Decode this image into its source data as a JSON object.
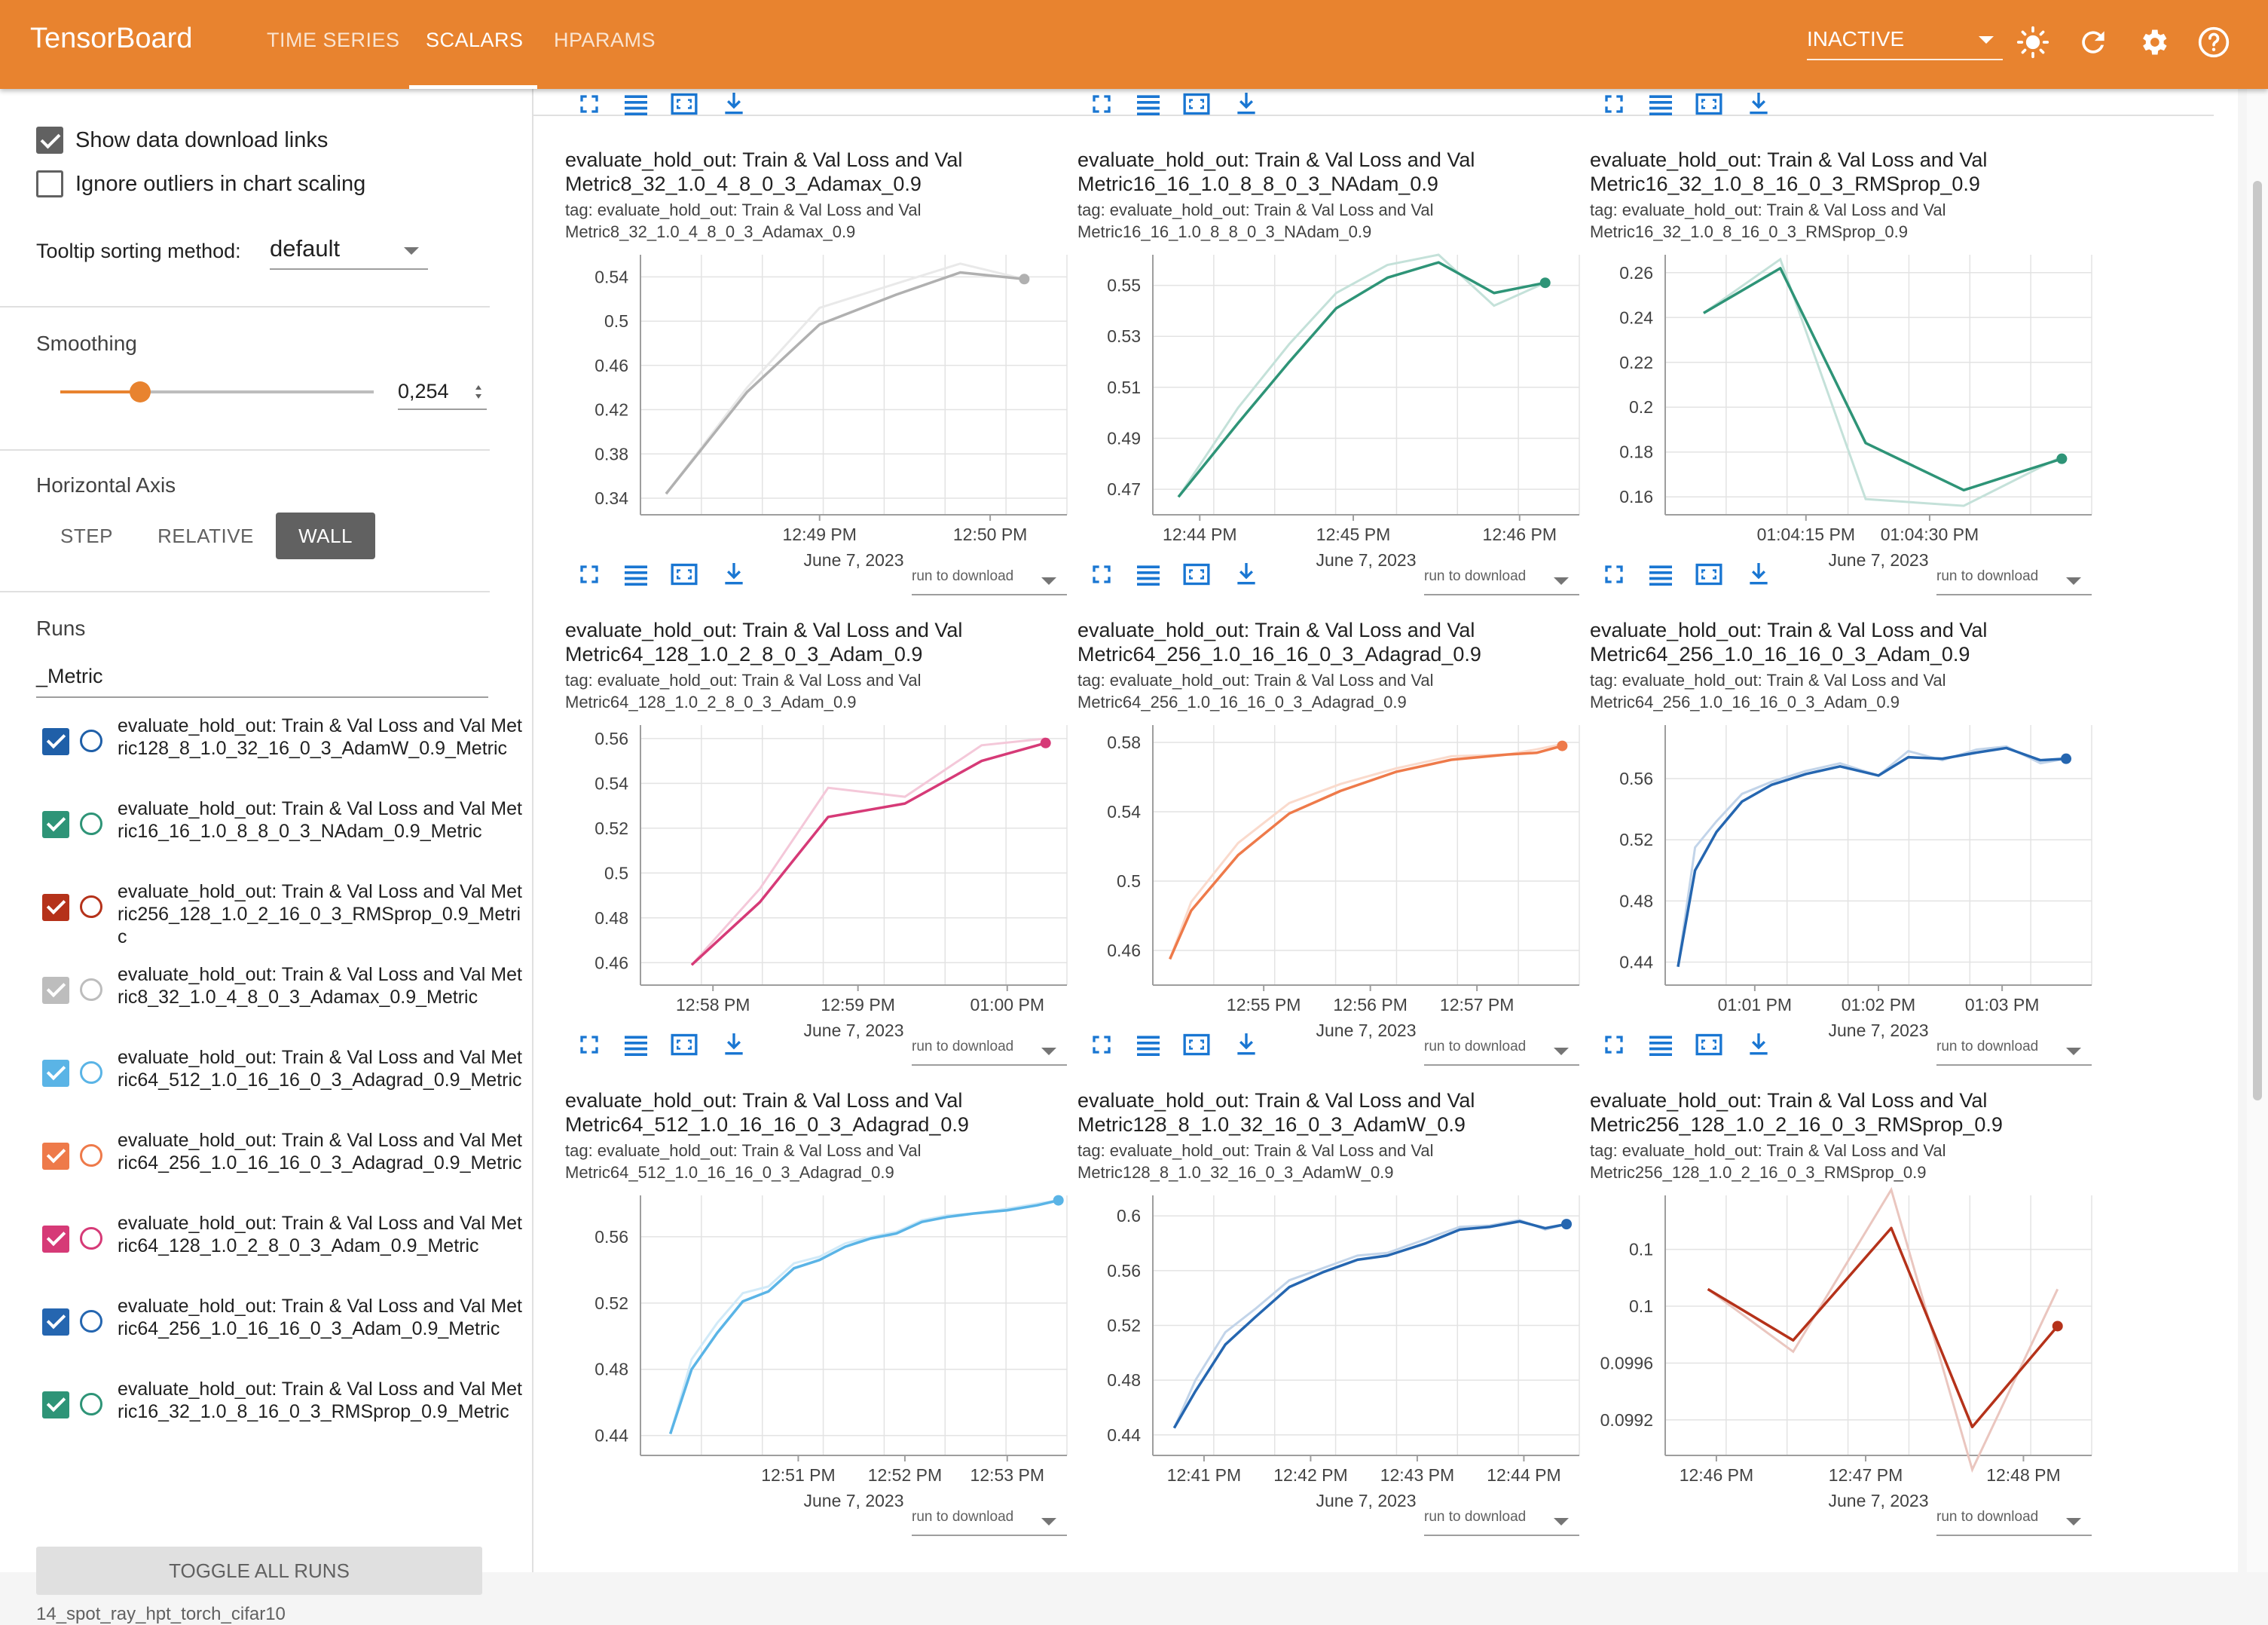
{
  "header": {
    "brand": "TensorBoard",
    "tabs": [
      {
        "label": "TIME SERIES",
        "active": false
      },
      {
        "label": "SCALARS",
        "active": true
      },
      {
        "label": "HPARAMS",
        "active": false
      }
    ],
    "reload_mode": "INACTIVE",
    "icons": [
      "brightness-icon",
      "refresh-icon",
      "settings-icon",
      "help-icon"
    ],
    "color": "#e8832f"
  },
  "sidebar": {
    "show_download_links": {
      "label": "Show data download links",
      "checked": true
    },
    "ignore_outliers": {
      "label": "Ignore outliers in chart scaling",
      "checked": false
    },
    "tooltip_sorting": {
      "label": "Tooltip sorting method:",
      "value": "default"
    },
    "smoothing": {
      "label": "Smoothing",
      "value": "0,254",
      "fraction": 0.254
    },
    "horizontal_axis": {
      "label": "Horizontal Axis",
      "options": [
        "STEP",
        "RELATIVE",
        "WALL"
      ],
      "selected": "WALL"
    },
    "runs": {
      "label": "Runs",
      "filter": "_Metric",
      "items": [
        {
          "label": "evaluate_hold_out: Train & Val Loss and Val Metric128_8_1.0_32_16_0_3_AdamW_0.9_Metric",
          "color": "#1f5fa8",
          "checked": true
        },
        {
          "label": "evaluate_hold_out: Train & Val Loss and Val Metric16_16_1.0_8_8_0_3_NAdam_0.9_Metric",
          "color": "#2e9477",
          "checked": true
        },
        {
          "label": "evaluate_hold_out: Train & Val Loss and Val Metric256_128_1.0_2_16_0_3_RMSprop_0.9_Metric",
          "color": "#b5321a",
          "checked": true
        },
        {
          "label": "evaluate_hold_out: Train & Val Loss and Val Metric8_32_1.0_4_8_0_3_Adamax_0.9_Metric",
          "color": "#bdbdbd",
          "checked": true
        },
        {
          "label": "evaluate_hold_out: Train & Val Loss and Val Metric64_512_1.0_16_16_0_3_Adagrad_0.9_Metric",
          "color": "#5ab4e6",
          "checked": true
        },
        {
          "label": "evaluate_hold_out: Train & Val Loss and Val Metric64_256_1.0_16_16_0_3_Adagrad_0.9_Metric",
          "color": "#ee7a4a",
          "checked": true
        },
        {
          "label": "evaluate_hold_out: Train & Val Loss and Val Metric64_128_1.0_2_8_0_3_Adam_0.9_Metric",
          "color": "#d63a77",
          "checked": true
        },
        {
          "label": "evaluate_hold_out: Train & Val Loss and Val Metric64_256_1.0_16_16_0_3_Adam_0.9_Metric",
          "color": "#2566b0",
          "checked": true
        },
        {
          "label": "evaluate_hold_out: Train & Val Loss and Val Metric16_32_1.0_8_16_0_3_RMSprop_0.9_Metric",
          "color": "#2e9477",
          "checked": true
        }
      ]
    },
    "toggle_all": "TOGGLE ALL RUNS",
    "footer": "14_spot_ray_hpt_torch_cifar10"
  },
  "cards": [
    {
      "title": "evaluate_hold_out: Train & Val Loss and Val Metric8_32_1.0_4_8_0_3_Adamax_0.9",
      "tag": "tag: evaluate_hold_out: Train & Val Loss and Val Metric8_32_1.0_4_8_0_3_Adamax_0.9",
      "run_to_download": "run to download"
    },
    {
      "title": "evaluate_hold_out: Train & Val Loss and Val Metric16_16_1.0_8_8_0_3_NAdam_0.9",
      "tag": "tag: evaluate_hold_out: Train & Val Loss and Val Metric16_16_1.0_8_8_0_3_NAdam_0.9",
      "run_to_download": "run to download"
    },
    {
      "title": "evaluate_hold_out: Train & Val Loss and Val Metric16_32_1.0_8_16_0_3_RMSprop_0.9",
      "tag": "tag: evaluate_hold_out: Train & Val Loss and Val Metric16_32_1.0_8_16_0_3_RMSprop_0.9",
      "run_to_download": "run to download"
    },
    {
      "title": "evaluate_hold_out: Train & Val Loss and Val Metric64_128_1.0_2_8_0_3_Adam_0.9",
      "tag": "tag: evaluate_hold_out: Train & Val Loss and Val Metric64_128_1.0_2_8_0_3_Adam_0.9",
      "run_to_download": "run to download"
    },
    {
      "title": "evaluate_hold_out: Train & Val Loss and Val Metric64_256_1.0_16_16_0_3_Adagrad_0.9",
      "tag": "tag: evaluate_hold_out: Train & Val Loss and Val Metric64_256_1.0_16_16_0_3_Adagrad_0.9",
      "run_to_download": "run to download"
    },
    {
      "title": "evaluate_hold_out: Train & Val Loss and Val Metric64_256_1.0_16_16_0_3_Adam_0.9",
      "tag": "tag: evaluate_hold_out: Train & Val Loss and Val Metric64_256_1.0_16_16_0_3_Adam_0.9",
      "run_to_download": "run to download"
    },
    {
      "title": "evaluate_hold_out: Train & Val Loss and Val Metric64_512_1.0_16_16_0_3_Adagrad_0.9",
      "tag": "tag: evaluate_hold_out: Train & Val Loss and Val Metric64_512_1.0_16_16_0_3_Adagrad_0.9",
      "run_to_download": "run to download"
    },
    {
      "title": "evaluate_hold_out: Train & Val Loss and Val Metric128_8_1.0_32_16_0_3_AdamW_0.9",
      "tag": "tag: evaluate_hold_out: Train & Val Loss and Val Metric128_8_1.0_32_16_0_3_AdamW_0.9",
      "run_to_download": "run to download"
    },
    {
      "title": "evaluate_hold_out: Train & Val Loss and Val Metric256_128_1.0_2_16_0_3_RMSprop_0.9",
      "tag": "tag: evaluate_hold_out: Train & Val Loss and Val Metric256_128_1.0_2_16_0_3_RMSprop_0.9",
      "run_to_download": "run to download"
    }
  ],
  "chart_data": [
    {
      "type": "line",
      "color": "#b0b0b0",
      "x_label": "June 7, 2023",
      "yticks": [
        0.34,
        0.38,
        0.42,
        0.46,
        0.5,
        0.54
      ],
      "ytick_labels": [
        "0.34",
        "0.38",
        "0.42",
        "0.46",
        "0.5",
        "0.54"
      ],
      "ylim": [
        0.325,
        0.56
      ],
      "xticks": [
        0.42,
        0.82
      ],
      "xtick_labels": [
        "12:49 PM",
        "12:50 PM"
      ],
      "x": [
        0.06,
        0.25,
        0.42,
        0.6,
        0.75,
        0.9
      ],
      "smoothed": [
        0.344,
        0.436,
        0.497,
        0.524,
        0.544,
        0.538
      ],
      "raw": [
        0.344,
        0.44,
        0.512,
        0.534,
        0.552,
        0.538
      ]
    },
    {
      "type": "line",
      "color": "#2e9477",
      "x_label": "June 7, 2023",
      "yticks": [
        0.47,
        0.49,
        0.51,
        0.53,
        0.55
      ],
      "ytick_labels": [
        "0.47",
        "0.49",
        "0.51",
        "0.53",
        "0.55"
      ],
      "ylim": [
        0.46,
        0.562
      ],
      "xticks": [
        0.11,
        0.47,
        0.86
      ],
      "xtick_labels": [
        "12:44 PM",
        "12:45 PM",
        "12:46 PM"
      ],
      "x": [
        0.06,
        0.2,
        0.32,
        0.43,
        0.55,
        0.67,
        0.8,
        0.92
      ],
      "smoothed": [
        0.467,
        0.496,
        0.52,
        0.541,
        0.553,
        0.559,
        0.547,
        0.551
      ],
      "raw": [
        0.467,
        0.502,
        0.527,
        0.547,
        0.558,
        0.562,
        0.542,
        0.551
      ]
    },
    {
      "type": "line",
      "color": "#2e9477",
      "x_label": "June 7, 2023",
      "yticks": [
        0.16,
        0.18,
        0.2,
        0.22,
        0.24,
        0.26
      ],
      "ytick_labels": [
        "0.16",
        "0.18",
        "0.2",
        "0.22",
        "0.24",
        "0.26"
      ],
      "ylim": [
        0.152,
        0.268
      ],
      "xticks": [
        0.33,
        0.62
      ],
      "xtick_labels": [
        "01:04:15 PM",
        "01:04:30 PM"
      ],
      "x": [
        0.09,
        0.27,
        0.47,
        0.7,
        0.93
      ],
      "smoothed": [
        0.242,
        0.262,
        0.184,
        0.163,
        0.177
      ],
      "raw": [
        0.242,
        0.266,
        0.159,
        0.156,
        0.178
      ]
    },
    {
      "type": "line",
      "color": "#d63a77",
      "x_label": "June 7, 2023",
      "yticks": [
        0.46,
        0.48,
        0.5,
        0.52,
        0.54,
        0.56
      ],
      "ytick_labels": [
        "0.46",
        "0.48",
        "0.5",
        "0.52",
        "0.54",
        "0.56"
      ],
      "ylim": [
        0.45,
        0.566
      ],
      "xticks": [
        0.17,
        0.51,
        0.86
      ],
      "xtick_labels": [
        "12:58 PM",
        "12:59 PM",
        "01:00 PM"
      ],
      "x": [
        0.12,
        0.28,
        0.44,
        0.62,
        0.8,
        0.95
      ],
      "smoothed": [
        0.459,
        0.487,
        0.525,
        0.531,
        0.55,
        0.558
      ],
      "raw": [
        0.459,
        0.493,
        0.538,
        0.534,
        0.557,
        0.56
      ]
    },
    {
      "type": "line",
      "color": "#ee7a4a",
      "x_label": "June 7, 2023",
      "yticks": [
        0.46,
        0.5,
        0.54,
        0.58
      ],
      "ytick_labels": [
        "0.46",
        "0.5",
        "0.54",
        "0.58"
      ],
      "ylim": [
        0.44,
        0.59
      ],
      "xticks": [
        0.26,
        0.51,
        0.76
      ],
      "xtick_labels": [
        "12:55 PM",
        "12:56 PM",
        "12:57 PM"
      ],
      "x": [
        0.04,
        0.09,
        0.2,
        0.32,
        0.44,
        0.57,
        0.7,
        0.83,
        0.9,
        0.96
      ],
      "smoothed": [
        0.455,
        0.483,
        0.515,
        0.539,
        0.552,
        0.563,
        0.57,
        0.573,
        0.574,
        0.578
      ],
      "raw": [
        0.455,
        0.488,
        0.522,
        0.545,
        0.556,
        0.565,
        0.572,
        0.573,
        0.576,
        0.579
      ]
    },
    {
      "type": "line",
      "color": "#2566b0",
      "x_label": "June 7, 2023",
      "yticks": [
        0.44,
        0.48,
        0.52,
        0.56
      ],
      "ytick_labels": [
        "0.44",
        "0.48",
        "0.52",
        "0.56"
      ],
      "ylim": [
        0.425,
        0.595
      ],
      "xticks": [
        0.21,
        0.5,
        0.79
      ],
      "xtick_labels": [
        "01:01 PM",
        "01:02 PM",
        "01:03 PM"
      ],
      "x": [
        0.03,
        0.07,
        0.12,
        0.18,
        0.25,
        0.33,
        0.41,
        0.5,
        0.57,
        0.65,
        0.73,
        0.8,
        0.88,
        0.94
      ],
      "smoothed": [
        0.437,
        0.5,
        0.525,
        0.545,
        0.556,
        0.563,
        0.568,
        0.562,
        0.574,
        0.573,
        0.577,
        0.58,
        0.572,
        0.573
      ],
      "raw": [
        0.437,
        0.515,
        0.532,
        0.55,
        0.558,
        0.565,
        0.57,
        0.562,
        0.578,
        0.572,
        0.579,
        0.581,
        0.57,
        0.573
      ]
    },
    {
      "type": "line",
      "color": "#5ab4e6",
      "x_label": "June 7, 2023",
      "yticks": [
        0.44,
        0.48,
        0.52,
        0.56
      ],
      "ytick_labels": [
        "0.44",
        "0.48",
        "0.52",
        "0.56"
      ],
      "ylim": [
        0.428,
        0.585
      ],
      "xticks": [
        0.37,
        0.62,
        0.86
      ],
      "xtick_labels": [
        "12:51 PM",
        "12:52 PM",
        "12:53 PM"
      ],
      "x": [
        0.07,
        0.12,
        0.18,
        0.24,
        0.3,
        0.36,
        0.42,
        0.48,
        0.54,
        0.6,
        0.66,
        0.72,
        0.78,
        0.86,
        0.93,
        0.98
      ],
      "smoothed": [
        0.441,
        0.48,
        0.502,
        0.521,
        0.527,
        0.541,
        0.546,
        0.554,
        0.559,
        0.562,
        0.569,
        0.572,
        0.574,
        0.576,
        0.579,
        0.582
      ],
      "raw": [
        0.441,
        0.486,
        0.508,
        0.526,
        0.53,
        0.544,
        0.548,
        0.556,
        0.56,
        0.563,
        0.57,
        0.573,
        0.574,
        0.577,
        0.58,
        0.582
      ]
    },
    {
      "type": "line",
      "color": "#2566b0",
      "x_label": "June 7, 2023",
      "yticks": [
        0.44,
        0.48,
        0.52,
        0.56,
        0.6
      ],
      "ytick_labels": [
        "0.44",
        "0.48",
        "0.52",
        "0.56",
        "0.6"
      ],
      "ylim": [
        0.425,
        0.615
      ],
      "xticks": [
        0.12,
        0.37,
        0.62,
        0.87
      ],
      "xtick_labels": [
        "12:41 PM",
        "12:42 PM",
        "12:43 PM",
        "12:44 PM"
      ],
      "x": [
        0.05,
        0.1,
        0.17,
        0.24,
        0.32,
        0.4,
        0.48,
        0.55,
        0.64,
        0.72,
        0.79,
        0.86,
        0.92,
        0.97
      ],
      "smoothed": [
        0.445,
        0.472,
        0.506,
        0.526,
        0.548,
        0.559,
        0.568,
        0.571,
        0.58,
        0.59,
        0.592,
        0.596,
        0.591,
        0.594
      ],
      "raw": [
        0.445,
        0.48,
        0.515,
        0.532,
        0.553,
        0.562,
        0.571,
        0.573,
        0.583,
        0.592,
        0.593,
        0.597,
        0.59,
        0.594
      ]
    },
    {
      "type": "line",
      "color": "#b5321a",
      "x_label": "June 7, 2023",
      "yticks": [
        0.0992,
        0.0996,
        0.1,
        0.1004
      ],
      "ytick_labels": [
        "0.0992",
        "0.0996",
        "0.1",
        "0.1"
      ],
      "ylim": [
        0.09895,
        0.10078
      ],
      "xticks": [
        0.12,
        0.47,
        0.84
      ],
      "xtick_labels": [
        "12:46 PM",
        "12:47 PM",
        "12:48 PM"
      ],
      "x": [
        0.1,
        0.3,
        0.53,
        0.72,
        0.92
      ],
      "smoothed": [
        0.10012,
        0.09976,
        0.10055,
        0.09915,
        0.09986
      ],
      "raw": [
        0.10012,
        0.09968,
        0.10082,
        0.09885,
        0.10012
      ]
    }
  ]
}
